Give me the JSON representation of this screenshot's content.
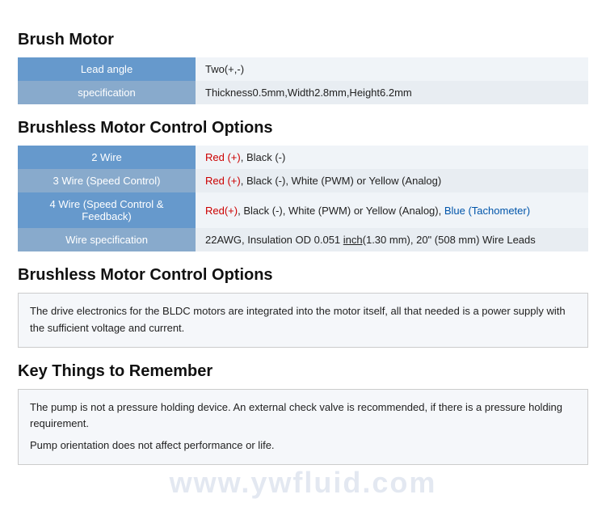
{
  "sections": [
    {
      "id": "brush-motor",
      "title": "Brush Motor",
      "rows": [
        {
          "label": "Lead angle",
          "value_plain": "Two(+,-)",
          "value_html": "Two(+,-)"
        },
        {
          "label": "specification",
          "value_plain": "Thickness0.5mm,Width2.8mm,Height6.2mm",
          "value_html": "Thickness0.5mm,Width2.8mm,Height6.2mm"
        }
      ]
    },
    {
      "id": "brushless-motor-control",
      "title": "Brushless Motor Control Options",
      "rows": [
        {
          "label": "2 Wire",
          "value_plain": "Red (+), Black (-)",
          "value_html": "<span class='red'>Red (+)</span>, Black (-)"
        },
        {
          "label": "3 Wire (Speed Control)",
          "value_plain": "Red (+), Black (-), White (PWM) or Yellow (Analog)",
          "value_html": "<span class='red'>Red (+)</span>, Black (-), White (PWM) or Yellow (Analog)"
        },
        {
          "label": "4 Wire (Speed Control & Feedback)",
          "value_plain": "Red(+), Black (-), White (PWM) or Yellow (Analog), Blue (Tachometer)",
          "value_html": "<span class='red'>Red(+)</span>, Black (-), White (PWM) or Yellow (Analog), <span class='blue'>Blue (Tachometer)</span>"
        },
        {
          "label": "Wire specification",
          "value_plain": "22AWG, Insulation OD 0.051 inch(1.30 mm), 20\" (508 mm) Wire Leads",
          "value_html": "22AWG, Insulation OD 0.051 <span style='text-decoration:underline'>inch</span>(1.30 mm), 20\" (508 mm) Wire Leads"
        }
      ]
    }
  ],
  "description_section": {
    "title": "Brushless Motor Control Options",
    "text": "The drive electronics for the BLDC motors are integrated into the motor itself, all that needed is a power supply with the sufficient voltage and current."
  },
  "key_things": {
    "title": "Key Things to Remember",
    "lines": [
      "The pump is not a pressure holding device. An external check valve is recommended, if there is a pressure holding requirement.",
      "Pump orientation does not affect performance or life."
    ]
  },
  "watermark": "www.ywfluid.com"
}
